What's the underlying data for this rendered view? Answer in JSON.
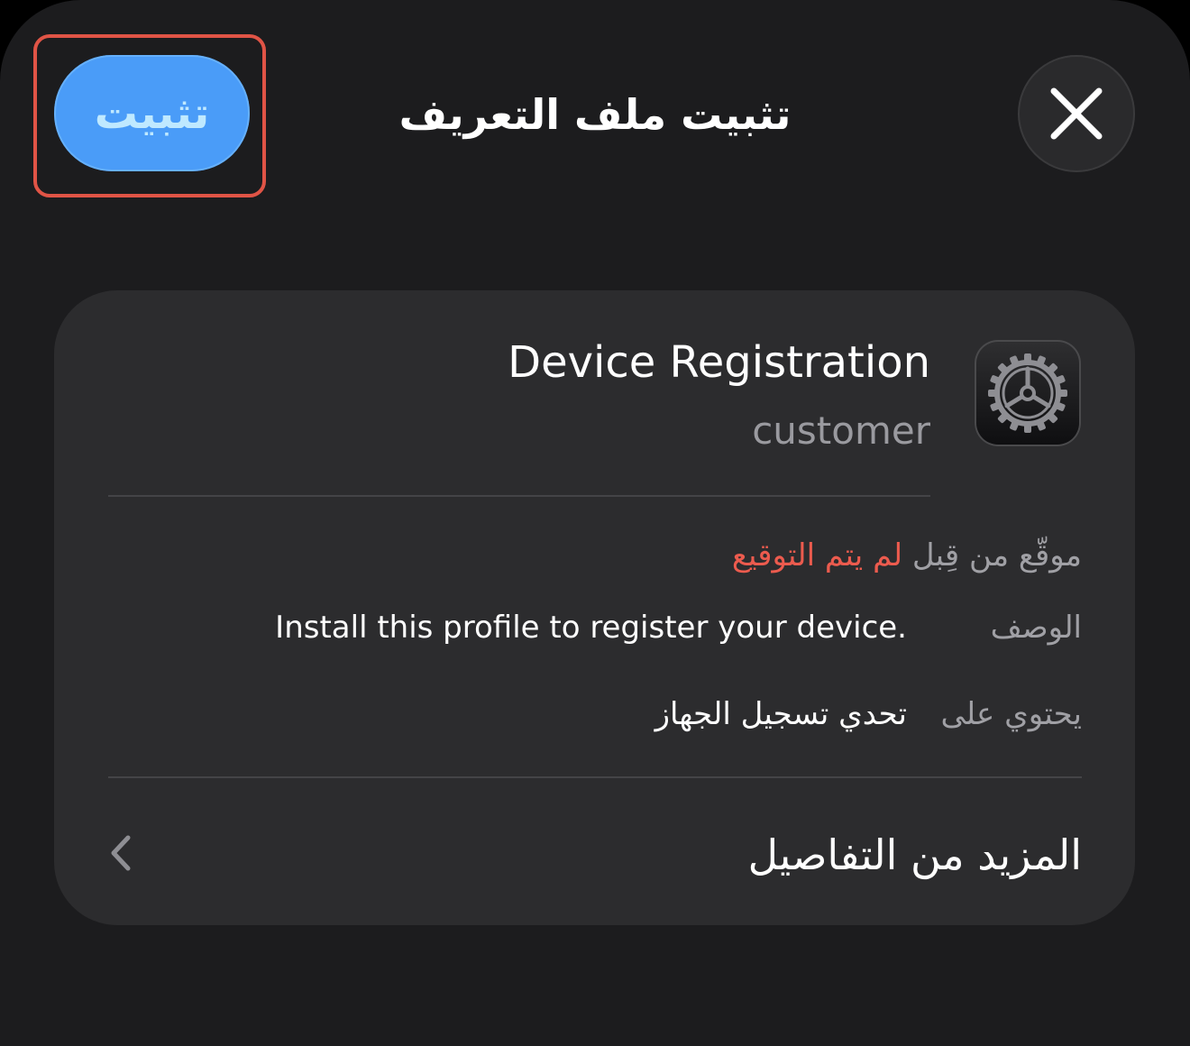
{
  "header": {
    "install_label": "تثبيت",
    "title": "تثبيت ملف التعريف",
    "close_icon": "close-icon"
  },
  "profile": {
    "icon": "settings-gear-icon",
    "name": "Device Registration",
    "organization": "customer"
  },
  "details": {
    "signed_by_label": "موقّع من قِبل",
    "signed_by_value": "لم يتم التوقيع",
    "description_label": "الوصف",
    "description_value": "Install this profile to register your device.",
    "contains_label": "يحتوي على",
    "contains_value": "تحدي تسجيل الجهاز"
  },
  "more_details": {
    "label": "المزيد من التفاصيل",
    "chevron_icon": "chevron-left-icon"
  },
  "colors": {
    "sheet_background": "#1c1c1e",
    "card_background": "#2c2c2e",
    "accent_blue": "#4a9cf8",
    "warning_red": "#ec5b4e",
    "highlight_outline": "#e05446"
  }
}
